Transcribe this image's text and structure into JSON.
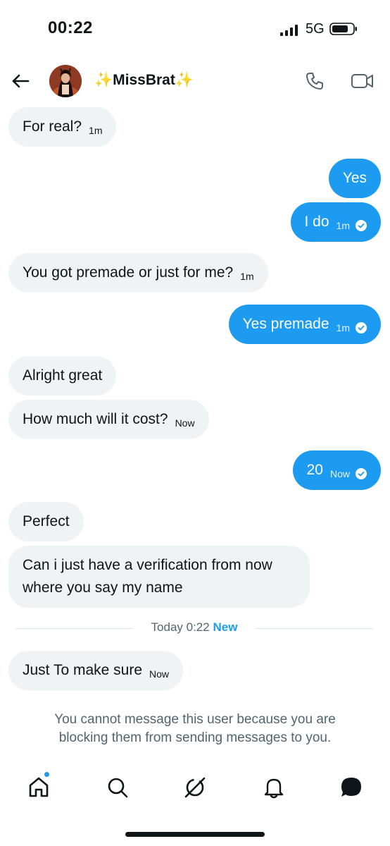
{
  "status_bar": {
    "time": "00:22",
    "network": "5G"
  },
  "header": {
    "contact_name": "✨MissBrat✨"
  },
  "messages": [
    {
      "text": "For real?",
      "time": "1m"
    },
    {
      "text": "Yes"
    },
    {
      "text": "I do",
      "time": "1m"
    },
    {
      "text": "You got premade or just for me?",
      "time": "1m"
    },
    {
      "text": "Yes premade",
      "time": "1m"
    },
    {
      "text": "Alright great"
    },
    {
      "text": "How much will it cost?",
      "time": "Now"
    },
    {
      "text": "20",
      "time": "Now"
    },
    {
      "text": "Perfect"
    },
    {
      "text_line1": "Can i just have a verification from now",
      "text_line2": "where you say my name"
    },
    {
      "text": "Just To make sure",
      "time": "Now"
    }
  ],
  "divider": {
    "label": "Today 0:22",
    "new_label": "New"
  },
  "blocked_notice": {
    "line1": "You cannot message this user because you are",
    "line2": "blocking them from sending messages to you."
  },
  "colors": {
    "accent": "#1d9bf0",
    "received_bubble": "#eff3f4",
    "muted_text": "#536471"
  },
  "icons": [
    "back-arrow-icon",
    "phone-icon",
    "video-icon",
    "home-icon",
    "search-icon",
    "grok-icon",
    "bell-icon",
    "messages-icon"
  ]
}
